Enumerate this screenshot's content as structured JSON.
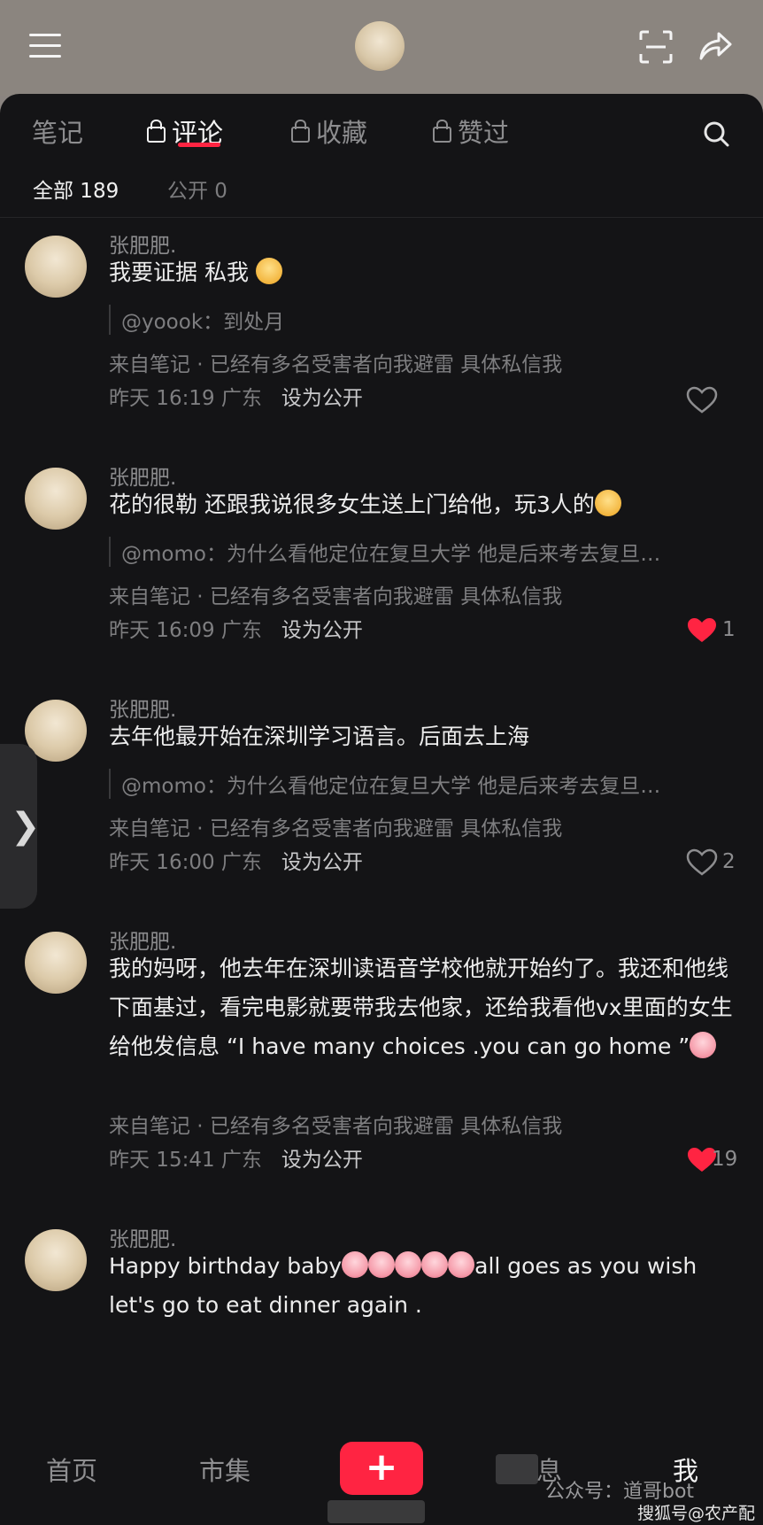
{
  "tabs": {
    "notes": "笔记",
    "comments": "评论",
    "collections": "收藏",
    "liked": "赞过"
  },
  "filters": {
    "all": "全部 189",
    "public": "公开 0"
  },
  "comments": [
    {
      "name": "张肥肥.",
      "text": "我要证据 私我",
      "quote": "@yoook：到处月",
      "source": "来自笔记 · 已经有多名受害者向我避雷 具体私信我",
      "time": "昨天 16:19 广东",
      "public_label": "设为公开",
      "likes": "",
      "liked": false
    },
    {
      "name": "张肥肥.",
      "text": "花的很勒 还跟我说很多女生送上门给他，玩3人的",
      "quote": "@momo：为什么看他定位在复旦大学 他是后来考去复旦…",
      "source": "来自笔记 · 已经有多名受害者向我避雷 具体私信我",
      "time": "昨天 16:09 广东",
      "public_label": "设为公开",
      "likes": "1",
      "liked": true
    },
    {
      "name": "张肥肥.",
      "text": "去年他最开始在深圳学习语言。后面去上海",
      "quote": "@momo：为什么看他定位在复旦大学 他是后来考去复旦…",
      "source": "来自笔记 · 已经有多名受害者向我避雷 具体私信我",
      "time": "昨天 16:00 广东",
      "public_label": "设为公开",
      "likes": "2",
      "liked": false
    },
    {
      "name": "张肥肥.",
      "text": "我的妈呀，他去年在深圳读语音学校他就开始约了。我还和他线下面基过，看完电影就要带我去他家，还给我看他vx里面的女生给他发信息 “I have many choices .you can go home ”",
      "source": "来自笔记 · 已经有多名受害者向我避雷 具体私信我",
      "time": "昨天 15:41 广东",
      "public_label": "设为公开",
      "likes": "19",
      "liked": true
    },
    {
      "name": "张肥肥.",
      "text_a": "Happy birthday baby",
      "text_b": "all goes as you wish let's go to eat dinner again ."
    }
  ],
  "nav": {
    "home": "首页",
    "market": "市集",
    "messages": "息",
    "me": "我"
  },
  "watermarks": {
    "wechat": "公众号：道哥bot",
    "sohu": "搜狐号@农产配"
  },
  "colors": {
    "accent": "#ff2442",
    "panel_bg": "#141416"
  }
}
